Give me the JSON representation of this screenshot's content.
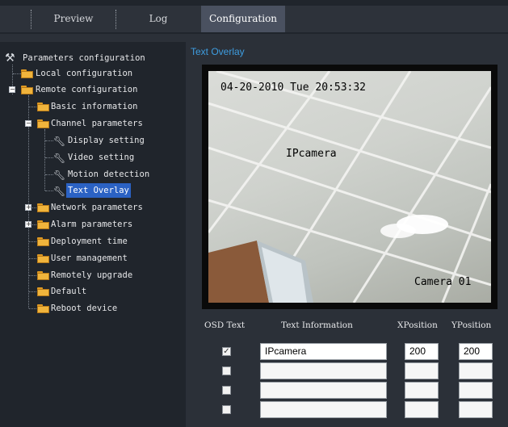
{
  "tabs": [
    {
      "label": "Preview",
      "active": false
    },
    {
      "label": "Log",
      "active": false
    },
    {
      "label": "Configuration",
      "active": true
    }
  ],
  "tree": {
    "root": "Parameters configuration",
    "items": [
      {
        "label": "Local configuration"
      },
      {
        "label": "Remote configuration"
      },
      {
        "label": "Basic information"
      },
      {
        "label": "Channel parameters"
      },
      {
        "label": "Display setting"
      },
      {
        "label": "Video setting"
      },
      {
        "label": "Motion detection"
      },
      {
        "label": "Text Overlay",
        "selected": true
      },
      {
        "label": "Network parameters"
      },
      {
        "label": "Alarm parameters"
      },
      {
        "label": "Deployment time"
      },
      {
        "label": "User management"
      },
      {
        "label": "Remotely upgrade"
      },
      {
        "label": "Default"
      },
      {
        "label": "Reboot device"
      }
    ]
  },
  "main": {
    "title": "Text Overlay"
  },
  "video": {
    "datetime": "04-20-2010 Tue 20:53:32",
    "text_overlay": "IPcamera",
    "camera_name": "Camera 01"
  },
  "osd_table": {
    "headers": {
      "osd_text": "OSD Text",
      "text_info": "Text Information",
      "xpos": "XPosition",
      "ypos": "YPosition"
    },
    "rows": [
      {
        "checked": true,
        "text": "IPcamera",
        "x": "200",
        "y": "200"
      },
      {
        "checked": false,
        "text": "",
        "x": "",
        "y": ""
      },
      {
        "checked": false,
        "text": "",
        "x": "",
        "y": ""
      },
      {
        "checked": false,
        "text": "",
        "x": "",
        "y": ""
      }
    ]
  },
  "colors": {
    "accent": "#3e9de0",
    "selection": "#2b62c4",
    "folder": "#f0b43c"
  }
}
